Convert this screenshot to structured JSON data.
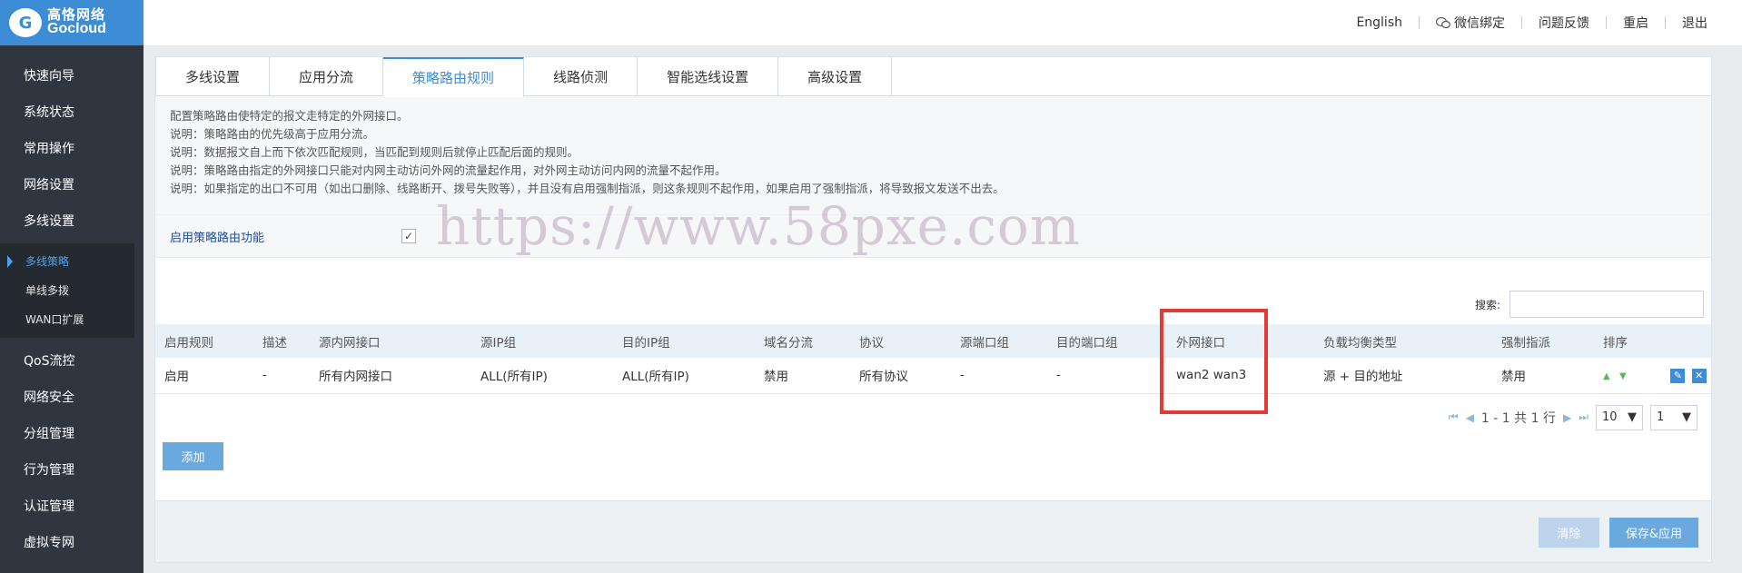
{
  "brand": {
    "logo_cn": "高恪网络",
    "logo_en": "Gocloud",
    "logo_glyph": "G"
  },
  "header": {
    "links": [
      "English",
      "微信绑定",
      "问题反馈",
      "重启",
      "退出"
    ]
  },
  "sidebar": {
    "items": [
      "快速向导",
      "系统状态",
      "常用操作",
      "网络设置",
      "多线设置"
    ],
    "subitems": [
      "多线策略",
      "单线多拨",
      "WAN口扩展"
    ],
    "items_after": [
      "QoS流控",
      "网络安全",
      "分组管理",
      "行为管理",
      "认证管理",
      "虚拟专网"
    ]
  },
  "tabs": [
    "多线设置",
    "应用分流",
    "策略路由规则",
    "线路侦测",
    "智能选线设置",
    "高级设置"
  ],
  "active_tab": "策略路由规则",
  "notes": [
    "配置策略路由使特定的报文走特定的外网接口。",
    "说明：策略路由的优先级高于应用分流。",
    "说明：数据报文自上而下依次匹配规则，当匹配到规则后就停止匹配后面的规则。",
    "说明：策略路由指定的外网接口只能对内网主动访问外网的流量起作用，对外网主动访问内网的流量不起作用。",
    "说明：如果指定的出口不可用（如出口删除、线路断开、拨号失败等），并且没有启用强制指派，则这条规则不起作用，如果启用了强制指派，将导致报文发送不出去。"
  ],
  "enable": {
    "label": "启用策略路由功能",
    "checked_glyph": "✓"
  },
  "watermark": "https://www.58pxe.com",
  "search": {
    "label": "搜索:",
    "placeholder": ""
  },
  "table": {
    "headers": [
      "启用规则",
      "描述",
      "源内网接口",
      "源IP组",
      "目的IP组",
      "域名分流",
      "协议",
      "源端口组",
      "目的端口组",
      "外网接口",
      "负载均衡类型",
      "强制指派",
      "排序"
    ],
    "rows": [
      [
        "启用",
        "-",
        "所有内网接口",
        "ALL(所有IP)",
        "ALL(所有IP)",
        "禁用",
        "所有协议",
        "-",
        "-",
        "wan2 wan3",
        "源 + 目的地址",
        "禁用"
      ]
    ]
  },
  "pager": {
    "summary": "1 - 1 共 1 行",
    "page_size": "10",
    "page": "1"
  },
  "buttons": {
    "add": "添加",
    "clear": "清除",
    "save": "保存&应用"
  }
}
